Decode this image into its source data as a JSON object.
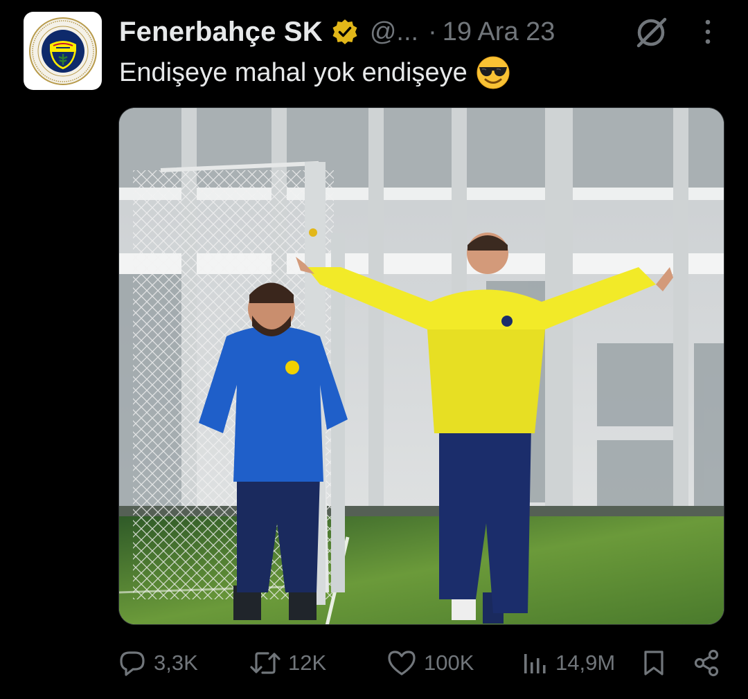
{
  "post": {
    "author": {
      "display_name": "Fenerbahçe SK",
      "handle": "@...",
      "verified": true,
      "verified_badge_color": "#e2b719",
      "avatar_icon": "fenerbahce-crest-icon"
    },
    "separator": "·",
    "date": "19 Ara 23",
    "text": "Endişeye mahal yok endişeye",
    "text_emoji": "smiling-face-with-sunglasses-emoji",
    "media": {
      "kind": "photo",
      "description_icon": "training-photo"
    },
    "actions": {
      "reply": {
        "icon": "reply-icon",
        "count": "3,3K"
      },
      "retweet": {
        "icon": "retweet-icon",
        "count": "12K"
      },
      "like": {
        "icon": "heart-icon",
        "count": "100K"
      },
      "views": {
        "icon": "views-bar-chart-icon",
        "count": "14,9M"
      },
      "bookmark": {
        "icon": "bookmark-icon"
      },
      "share": {
        "icon": "share-icon"
      }
    },
    "header_icons": [
      "grok-icon",
      "more-options-icon"
    ]
  },
  "colors": {
    "background": "#000000",
    "primary_text": "#e7e9ea",
    "secondary_text": "#71767b"
  }
}
